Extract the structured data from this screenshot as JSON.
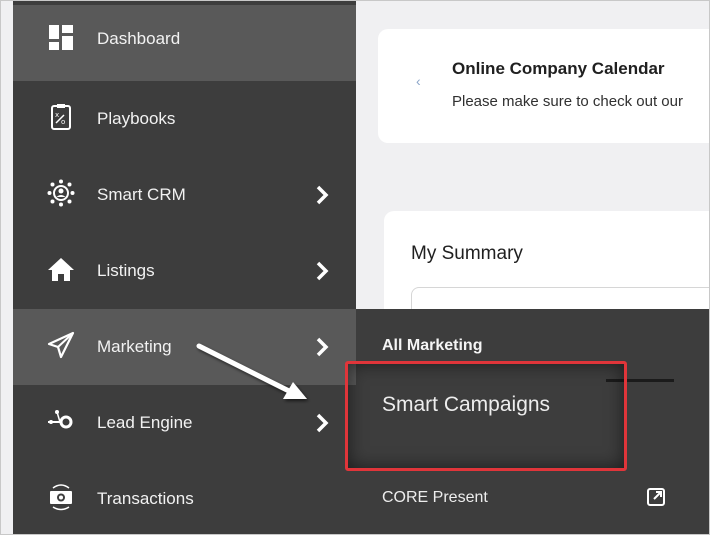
{
  "sidebar": {
    "items": [
      {
        "label": "Dashboard",
        "icon": "dashboard-icon",
        "has_chevron": false,
        "active": true
      },
      {
        "label": "Playbooks",
        "icon": "playbook-icon",
        "has_chevron": false,
        "active": false
      },
      {
        "label": "Smart CRM",
        "icon": "crm-network-icon",
        "has_chevron": true,
        "active": false
      },
      {
        "label": "Listings",
        "icon": "home-icon",
        "has_chevron": true,
        "active": false
      },
      {
        "label": "Marketing",
        "icon": "paper-plane-icon",
        "has_chevron": true,
        "active": true
      },
      {
        "label": "Lead Engine",
        "icon": "lead-engine-icon",
        "has_chevron": true,
        "active": false
      },
      {
        "label": "Transactions",
        "icon": "money-icon",
        "has_chevron": false,
        "active": false
      }
    ]
  },
  "main": {
    "calendar": {
      "title": "Online Company Calendar",
      "subtitle": "Please make sure to check out our",
      "prev_icon": "chevron-left-icon"
    },
    "summary": {
      "title": "My Summary"
    }
  },
  "submenu": {
    "header": "All Marketing",
    "items": [
      {
        "label": "Smart Campaigns",
        "highlighted": true
      },
      {
        "label": "CORE Present",
        "icon": "external-link-icon"
      }
    ]
  },
  "colors": {
    "sidebar_bg": "#3d3d3d",
    "sidebar_active": "#595959",
    "highlight": "#e0353a",
    "main_bg": "#f0f0f2"
  }
}
